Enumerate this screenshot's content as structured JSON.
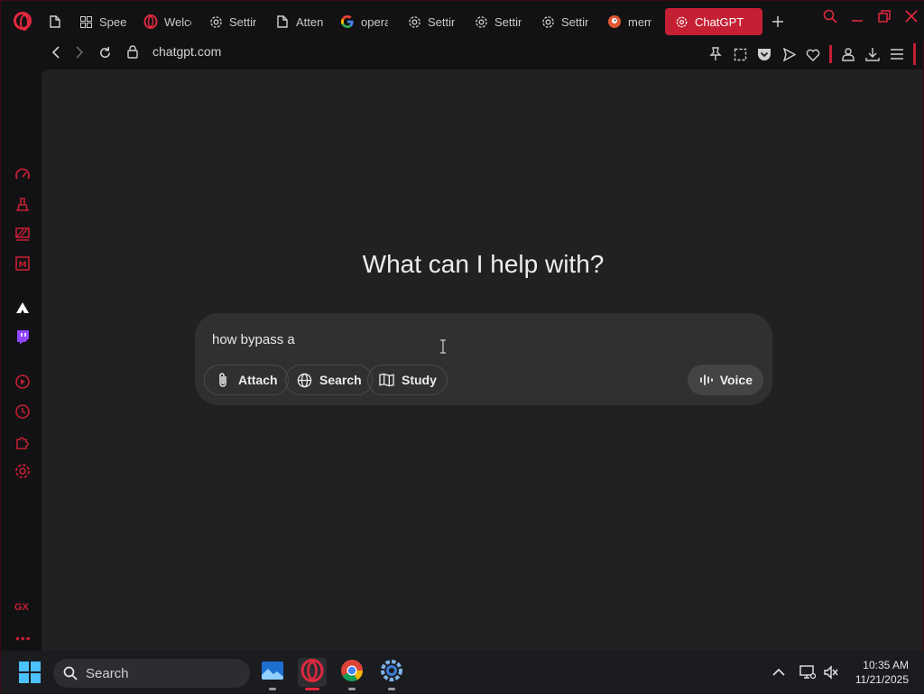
{
  "browser": {
    "url": "chatgpt.com",
    "tabs": [
      {
        "label": "Speed Dial",
        "icon": "grid-icon"
      },
      {
        "label": "Welcome",
        "icon": "opera-icon"
      },
      {
        "label": "Settings",
        "icon": "gear-icon"
      },
      {
        "label": "Attendance",
        "icon": "page-icon"
      },
      {
        "label": "opera",
        "icon": "google-icon"
      },
      {
        "label": "Settings",
        "icon": "gear-icon"
      },
      {
        "label": "Settings",
        "icon": "gear-icon"
      },
      {
        "label": "Settings",
        "icon": "gear-icon"
      },
      {
        "label": "memes",
        "icon": "duckduckgo-icon"
      }
    ],
    "active_tab": {
      "label": "ChatGPT",
      "icon": "chatgpt-icon"
    },
    "accent": "#c41f33"
  },
  "chat": {
    "heading": "What can I help with?",
    "input_text": "how bypass a",
    "buttons": {
      "attach": "Attach",
      "search": "Search",
      "study": "Study",
      "voice": "Voice"
    }
  },
  "taskbar": {
    "search_label": "Search",
    "time": "10:35 AM",
    "date": "11/21/2025"
  }
}
